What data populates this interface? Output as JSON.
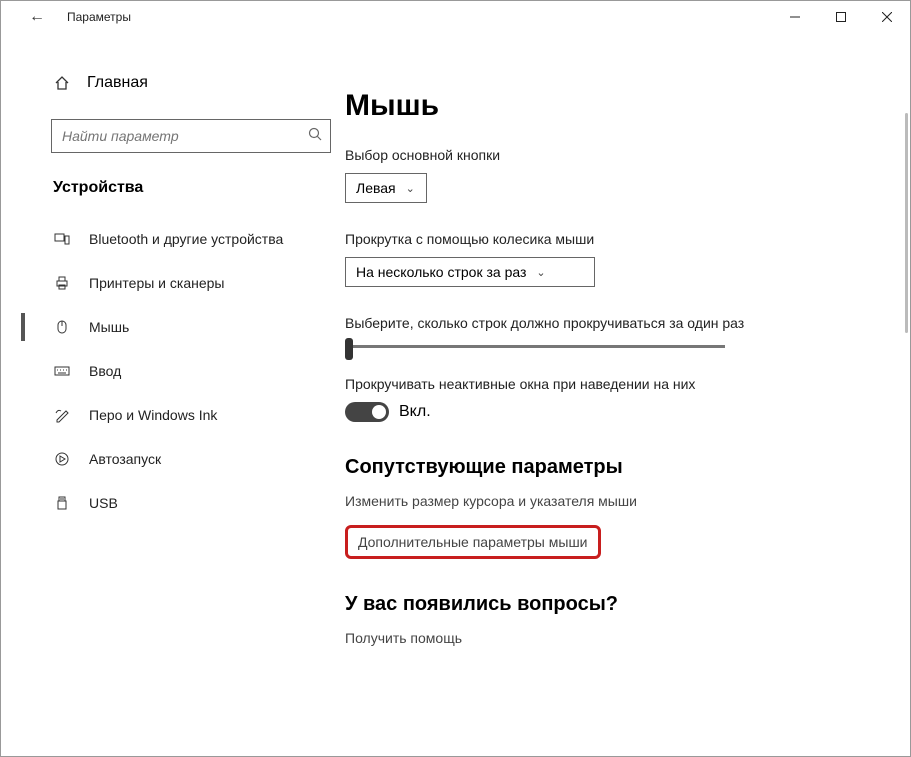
{
  "titlebar": {
    "title": "Параметры"
  },
  "home": {
    "label": "Главная"
  },
  "search": {
    "placeholder": "Найти параметр"
  },
  "section": "Устройства",
  "nav": [
    {
      "label": "Bluetooth и другие устройства"
    },
    {
      "label": "Принтеры и сканеры"
    },
    {
      "label": "Мышь"
    },
    {
      "label": "Ввод"
    },
    {
      "label": "Перо и Windows Ink"
    },
    {
      "label": "Автозапуск"
    },
    {
      "label": "USB"
    }
  ],
  "page": {
    "heading": "Мышь",
    "primary_button_label": "Выбор основной кнопки",
    "primary_button_value": "Левая",
    "scroll_label": "Прокрутка с помощью колесика мыши",
    "scroll_value": "На несколько строк за раз",
    "lines_label": "Выберите, сколько строк должно прокручиваться за один раз",
    "inactive_label": "Прокручивать неактивные окна при наведении на них",
    "toggle_text": "Вкл.",
    "related_heading": "Сопутствующие параметры",
    "link_cursor": "Изменить размер курсора и указателя мыши",
    "link_advanced": "Дополнительные параметры мыши",
    "help_heading": "У вас появились вопросы?",
    "link_help": "Получить помощь"
  }
}
